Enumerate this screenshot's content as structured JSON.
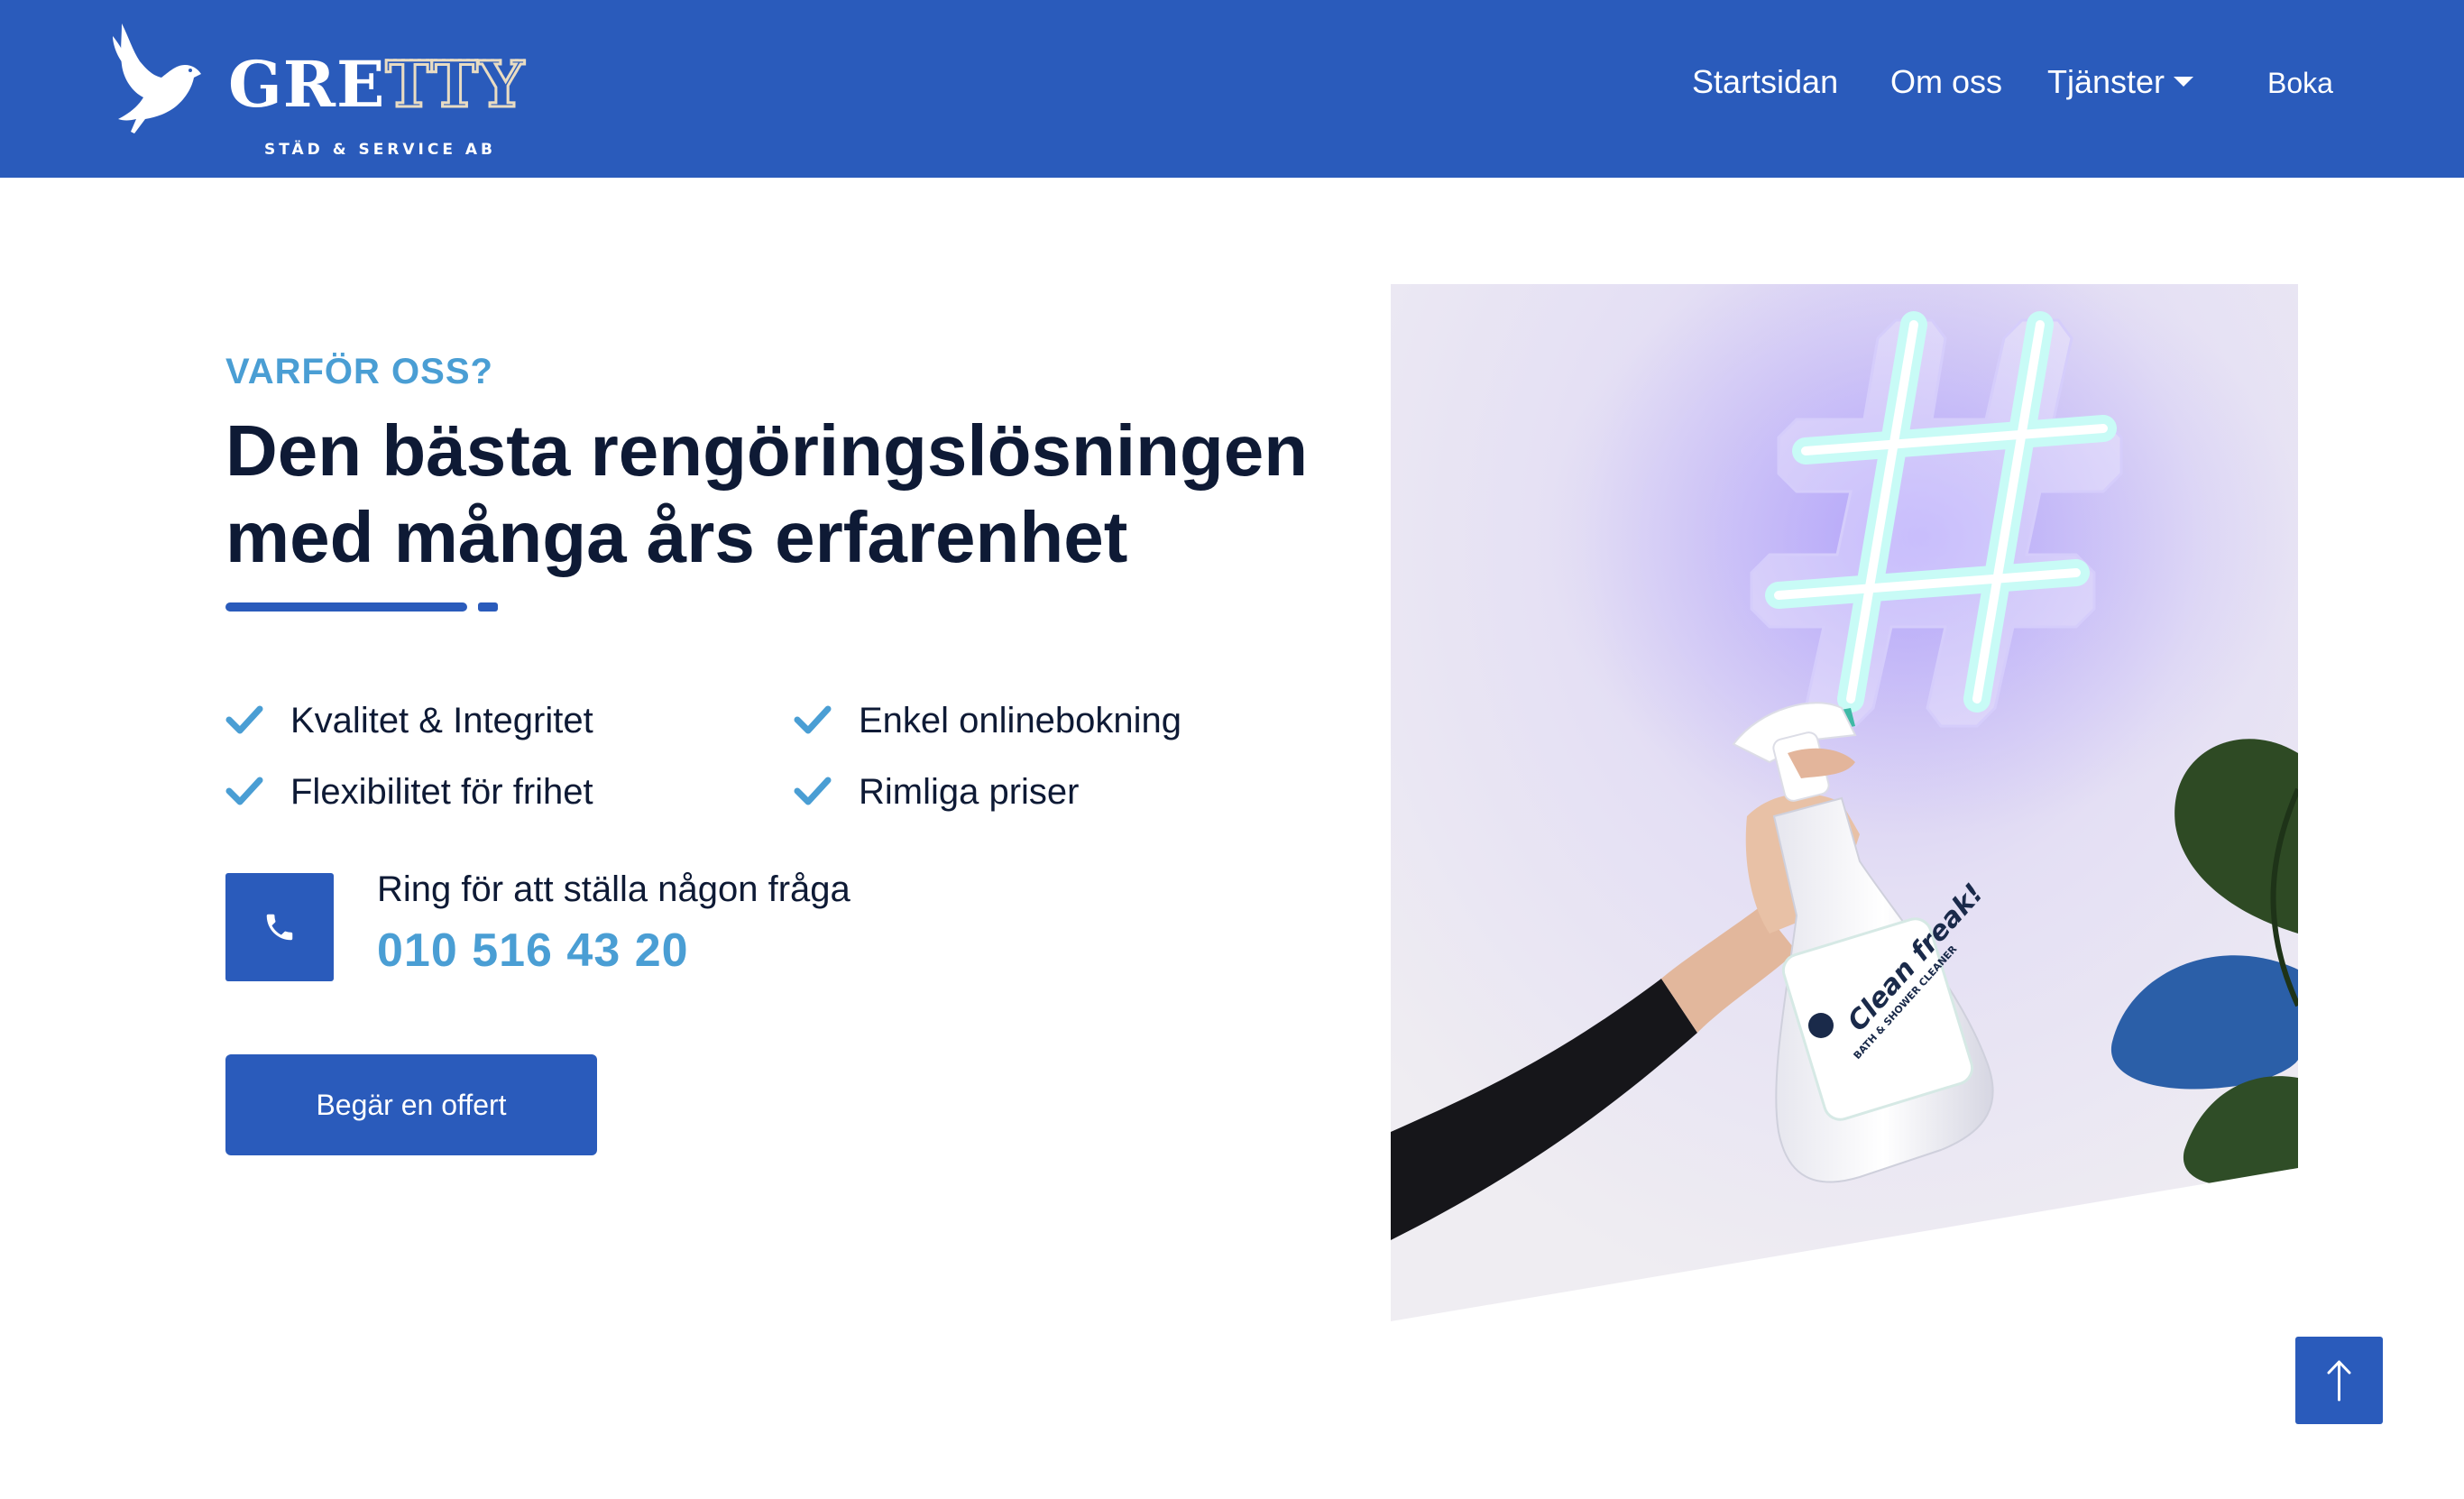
{
  "header": {
    "logo": {
      "wordmark_start": "GRE",
      "wordmark_accent": "TTY",
      "tagline": "STÄD & SERVICE AB",
      "icon": "dove-icon"
    },
    "nav": {
      "home": "Startsidan",
      "about": "Om oss",
      "services": "Tjänster",
      "book": "Boka"
    }
  },
  "section": {
    "eyebrow": "VARFÖR OSS?",
    "headline_line1": "Den bästa rengöringslösningen",
    "headline_line2": "med många års erfarenhet",
    "features": [
      {
        "label": "Kvalitet & Integritet",
        "icon": "check-icon"
      },
      {
        "label": "Enkel onlinebokning",
        "icon": "check-icon"
      },
      {
        "label": "Flexibilitet för frihet",
        "icon": "check-icon"
      },
      {
        "label": "Rimliga priser",
        "icon": "check-icon"
      }
    ],
    "call": {
      "icon": "phone-icon",
      "text": "Ring för att ställa någon fråga",
      "number": "010 516 43 20"
    },
    "cta_label": "Begär en offert",
    "image": {
      "subject": "neon hashtag sign and spray bottle",
      "bottle_label": "Clean freak!",
      "bottle_sub": "BATH & SHOWER CLEANER"
    }
  },
  "back_to_top": {
    "icon": "arrow-up-icon"
  },
  "colors": {
    "primary": "#2a5bbb",
    "accent": "#4a9ed4",
    "heading": "#0e1a35",
    "background": "#ffffff"
  }
}
